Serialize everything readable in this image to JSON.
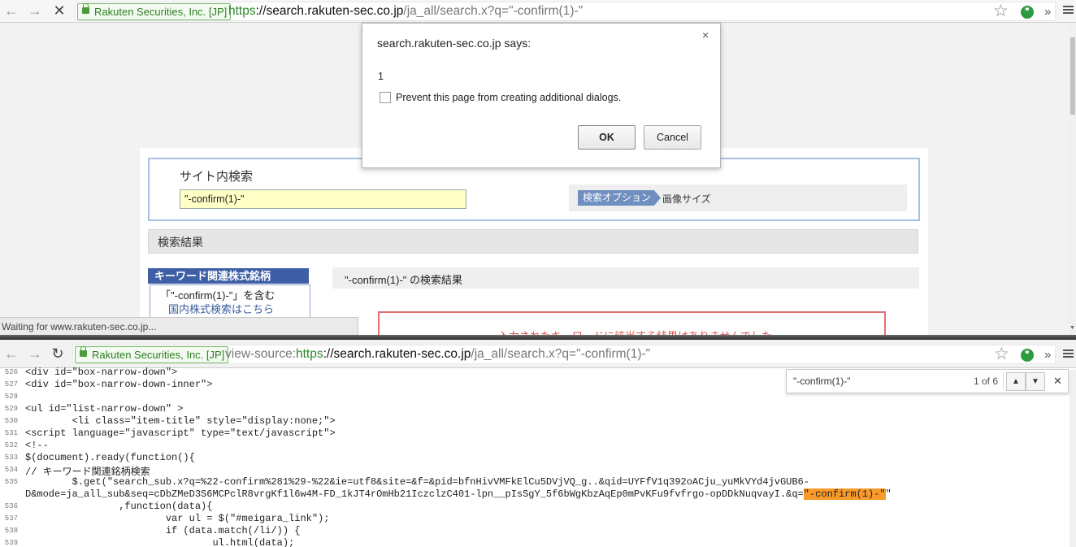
{
  "browser_top": {
    "ev_label": "Rakuten Securities, Inc. [JP]",
    "url_scheme": "https",
    "url_host": "://search.rakuten-sec.co.jp",
    "url_path": "/ja_all/search.x?q=\"-confirm(1)-\"",
    "status_text": "Waiting for www.rakuten-sec.co.jp..."
  },
  "page": {
    "search_title": "サイト内検索",
    "search_value": "\"-confirm(1)-\"",
    "option_tag": "検索オプション",
    "option_text": "画像サイズ",
    "results_header": "検索結果",
    "keyword_header": "キーワード関連株式銘柄",
    "keyword_line1": "「\"-confirm(1)-\"」を含む",
    "keyword_line2": "国内株式検索はこちら",
    "result_title": "\"-confirm(1)-\" の検索結果",
    "no_results": "入力されたキーワードに該当する結果はありませんでした。"
  },
  "dialog": {
    "title": "search.rakuten-sec.co.jp says:",
    "message": "1",
    "checkbox_label": "Prevent this page from creating additional dialogs.",
    "ok": "OK",
    "cancel": "Cancel",
    "close": "×"
  },
  "browser_bottom": {
    "ev_label": "Rakuten Securities, Inc. [JP]",
    "url_prefix": "view-source:",
    "url_scheme": "https",
    "url_host": "://search.rakuten-sec.co.jp",
    "url_path": "/ja_all/search.x?q=\"-confirm(1)-\""
  },
  "findbar": {
    "query": "\"-confirm(1)-\"",
    "count": "1 of 6"
  },
  "source_lines": [
    {
      "num": "526",
      "code": "<div id=\"box-narrow-down\">"
    },
    {
      "num": "527",
      "code": "<div id=\"box-narrow-down-inner\">"
    },
    {
      "num": "528",
      "code": ""
    },
    {
      "num": "529",
      "code": "<ul id=\"list-narrow-down\" >"
    },
    {
      "num": "530",
      "code": "        <li class=\"item-title\" style=\"display:none;\">"
    },
    {
      "num": "531",
      "code": "<script language=\"javascript\" type=\"text/javascript\">"
    },
    {
      "num": "532",
      "code": "<!--"
    },
    {
      "num": "533",
      "code": "$(document).ready(function(){"
    },
    {
      "num": "534",
      "code": "// キーワード関連銘柄検索"
    },
    {
      "num": "535",
      "code": "        $.get(\"search_sub.x?q=%22-confirm%281%29-%22&ie=utf8&site=&f=&pid=bfnHivVMFkElCu5DVjVQ_g..&qid=UYFfV1q392oACju_yuMkVYd4jvGUB6-"
    },
    {
      "num": "",
      "code": "D&mode=ja_all_sub&seq=cDbZMeD3S6MCPclR8vrgKf1l6w4M-FD_1kJT4rOmHb21IczclzC401-lpn__pIsSgY_5f6bWgKbzAqEp0mPvKFu9fvfrgo-opDDkNuqvayI.&q=",
      "hl": "\"-confirm(1)-\"",
      "after": "\""
    },
    {
      "num": "536",
      "code": "                ,function(data){"
    },
    {
      "num": "537",
      "code": "                        var ul = $(\"#meigara_link\");"
    },
    {
      "num": "538",
      "code": "                        if (data.match(/li/)) {"
    },
    {
      "num": "539",
      "code": "                                ul.html(data);"
    }
  ]
}
